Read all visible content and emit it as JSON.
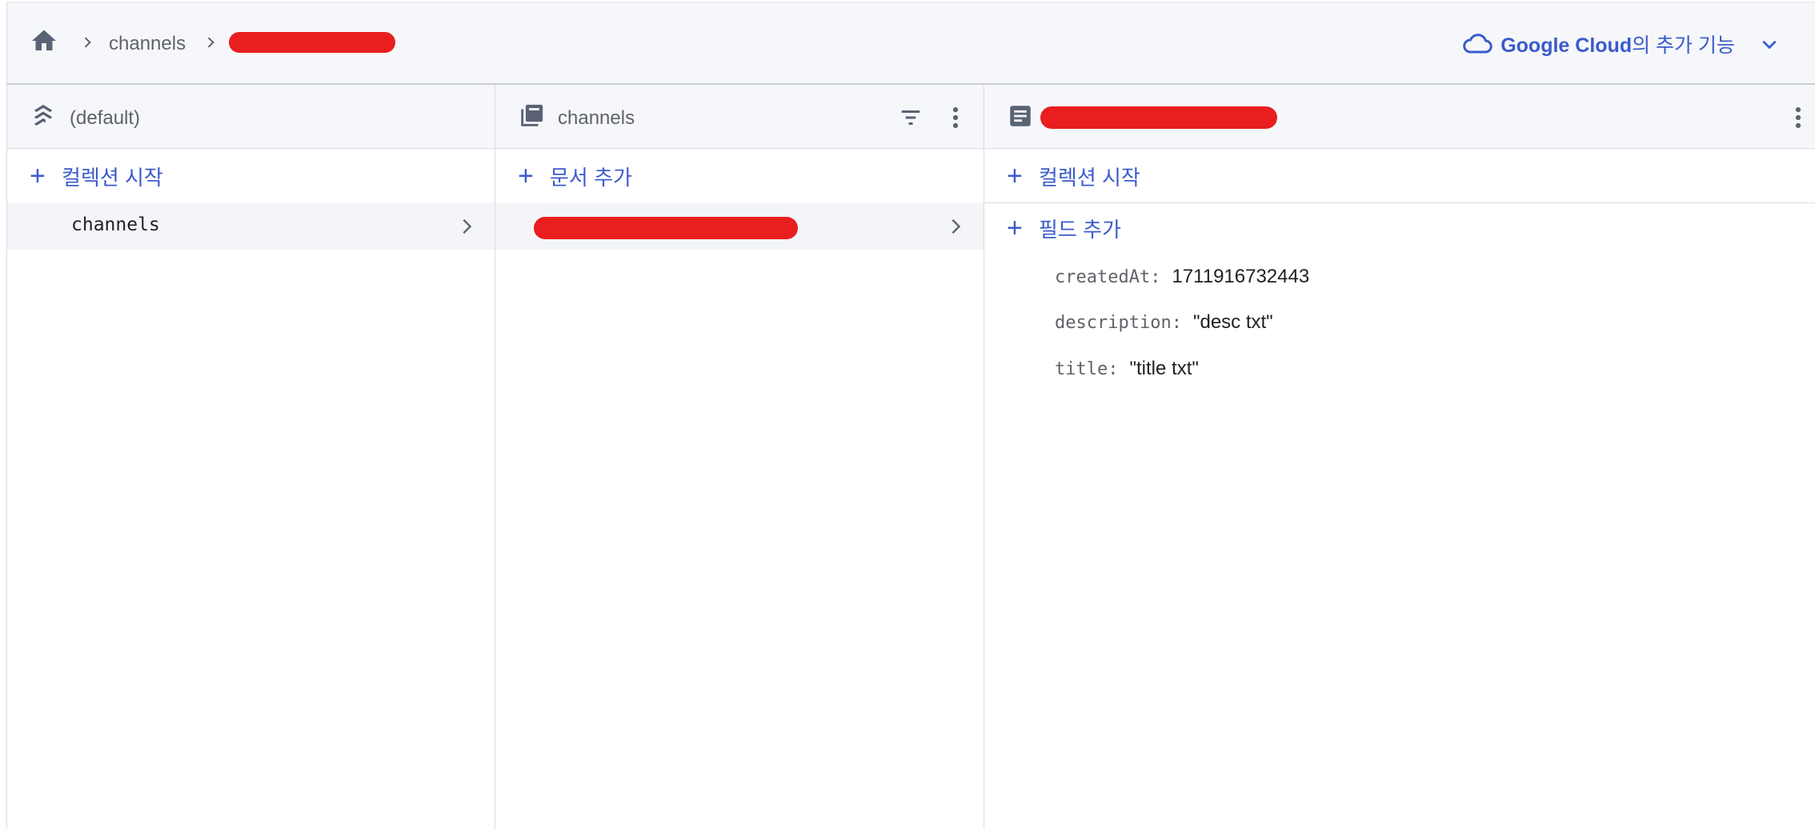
{
  "breadcrumb": {
    "items": [
      "channels"
    ]
  },
  "header_right": {
    "brand": "Google Cloud",
    "suffix": "의 추가 기능"
  },
  "columns": {
    "database": {
      "title": "(default)",
      "action": "컬렉션 시작",
      "items": [
        "channels"
      ]
    },
    "collection": {
      "title": "channels",
      "action": "문서 추가"
    },
    "document": {
      "action_collection": "컬렉션 시작",
      "action_field": "필드 추가",
      "fields": [
        {
          "key": "createdAt:",
          "value": "1711916732443"
        },
        {
          "key": "description:",
          "value": "\"desc txt\""
        },
        {
          "key": "title:",
          "value": "\"title txt\""
        }
      ]
    }
  },
  "colors": {
    "accent": "#3b5bcc",
    "redaction": "#e91e1e",
    "header_bg": "#f6f7fa"
  },
  "icons": [
    "home-icon",
    "chevron-right-icon",
    "cloud-icon",
    "chevron-down-icon",
    "database-layers-icon",
    "collection-icon",
    "filter-icon",
    "more-vert-icon",
    "document-icon",
    "plus-icon"
  ]
}
